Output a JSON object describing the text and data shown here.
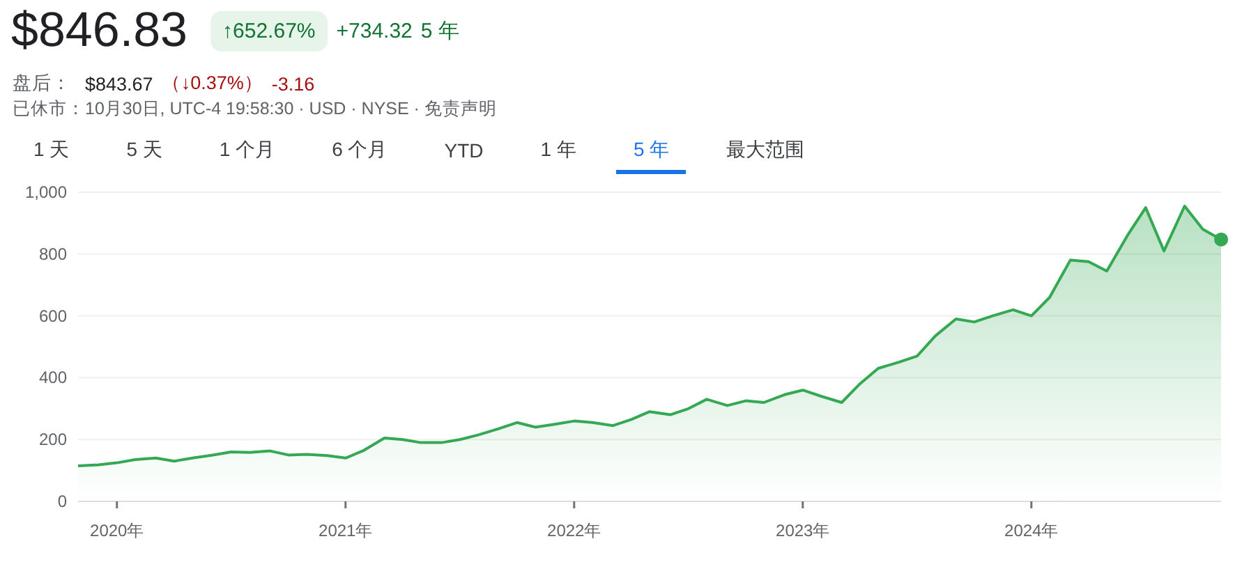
{
  "quote": {
    "price": "$846.83",
    "change_percent": "↑652.67%",
    "change_amount": "+734.32",
    "period": "5 年"
  },
  "after_hours": {
    "label": "盘后：",
    "price": "$843.67",
    "change": "（↓0.37%）",
    "change_amount": "-3.16"
  },
  "status": {
    "label": "已休市：",
    "details": "10月30日, UTC-4 19:58:30 · USD · NYSE · ",
    "disclaimer": "免责声明"
  },
  "ranges": [
    {
      "label": "1 天",
      "selected": false
    },
    {
      "label": "5 天",
      "selected": false
    },
    {
      "label": "1 个月",
      "selected": false
    },
    {
      "label": "6 个月",
      "selected": false
    },
    {
      "label": "YTD",
      "selected": false
    },
    {
      "label": "1 年",
      "selected": false
    },
    {
      "label": "5 年",
      "selected": true
    },
    {
      "label": "最大范围",
      "selected": false
    }
  ],
  "chart": {
    "chart_data": {
      "type": "area",
      "x": [
        2019.83,
        2019.92,
        2020.0,
        2020.08,
        2020.17,
        2020.25,
        2020.33,
        2020.42,
        2020.5,
        2020.58,
        2020.67,
        2020.75,
        2020.83,
        2020.92,
        2021.0,
        2021.08,
        2021.17,
        2021.25,
        2021.33,
        2021.42,
        2021.5,
        2021.58,
        2021.67,
        2021.75,
        2021.83,
        2021.92,
        2022.0,
        2022.08,
        2022.17,
        2022.25,
        2022.33,
        2022.42,
        2022.5,
        2022.58,
        2022.67,
        2022.75,
        2022.83,
        2022.92,
        2023.0,
        2023.08,
        2023.17,
        2023.25,
        2023.33,
        2023.42,
        2023.5,
        2023.58,
        2023.67,
        2023.75,
        2023.83,
        2023.92,
        2024.0,
        2024.08,
        2024.17,
        2024.25,
        2024.33,
        2024.42,
        2024.5,
        2024.58,
        2024.67,
        2024.75,
        2024.83
      ],
      "series": [
        {
          "color": "#34a853",
          "values": [
            115,
            118,
            125,
            135,
            140,
            130,
            140,
            150,
            160,
            158,
            163,
            150,
            152,
            148,
            140,
            165,
            205,
            200,
            190,
            190,
            200,
            215,
            235,
            255,
            240,
            250,
            260,
            255,
            245,
            265,
            290,
            280,
            300,
            330,
            310,
            325,
            320,
            345,
            360,
            340,
            320,
            380,
            430,
            450,
            470,
            535,
            590,
            580,
            600,
            620,
            600,
            660,
            780,
            775,
            745,
            860,
            950,
            810,
            955,
            880,
            847
          ]
        }
      ],
      "xlim": [
        2019.83,
        2024.83
      ],
      "ylim": [
        0,
        1000
      ],
      "grid": true,
      "yticks": [
        0,
        200,
        400,
        600,
        800,
        {
          "value": 1000,
          "label": "1,000"
        }
      ],
      "xticks": [
        {
          "value": 2020,
          "label": "2020年"
        },
        {
          "value": 2021,
          "label": "2021年"
        },
        {
          "value": 2022,
          "label": "2022年"
        },
        {
          "value": 2023,
          "label": "2023年"
        },
        {
          "value": 2024,
          "label": "2024年"
        }
      ]
    }
  }
}
